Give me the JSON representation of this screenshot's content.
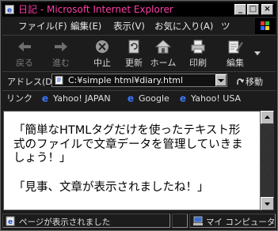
{
  "window": {
    "title": "日記 - Microsoft Internet Explorer",
    "controls": {
      "minimize": "_",
      "maximize": "□",
      "close": "×"
    }
  },
  "menu": [
    "ファイル(F)",
    "編集(E)",
    "表示(V)",
    "お気に入り(A)",
    "ツ"
  ],
  "toolbar": {
    "back": "戻る",
    "forward": "進む",
    "stop": "中止",
    "refresh": "更新",
    "home": "ホーム",
    "print": "印刷",
    "edit": "編集"
  },
  "address": {
    "label": "アドレス(D)",
    "url": "C:¥simple html¥diary.html",
    "go": "移動"
  },
  "links": {
    "label": "リンク",
    "items": [
      "Yahoo! JAPAN",
      "Google",
      "Yahoo! USA"
    ]
  },
  "content": {
    "paragraph1": "「簡単なHTMLタグだけを使ったテキスト形式のファイルで文章データを管理していきましょう！」",
    "paragraph2": "「見事、文章が表示されましたね！」"
  },
  "status": {
    "message": "ページが表示されました",
    "zone": "マイ コンピュータ"
  },
  "colors": {
    "title_text": "#ff3fa8",
    "content_bg": "#ffffff",
    "chrome_bg": "#1c1c1c"
  }
}
